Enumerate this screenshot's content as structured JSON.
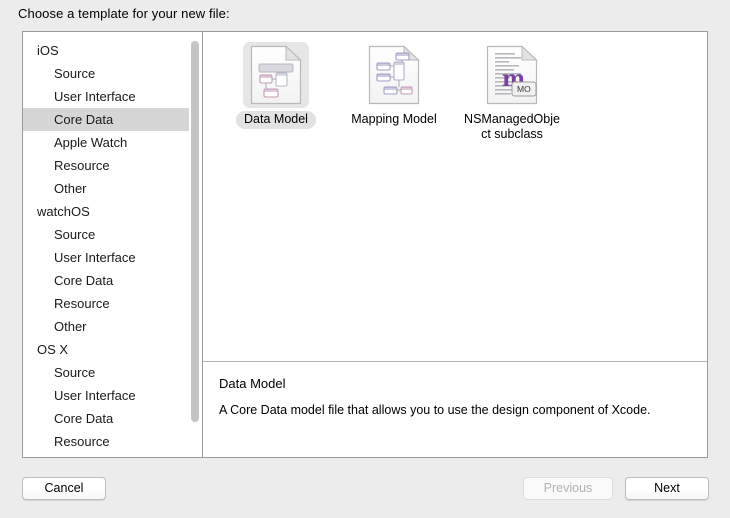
{
  "dialog": {
    "prompt": "Choose a template for your new file:"
  },
  "sidebar": {
    "rows": [
      {
        "label": "iOS",
        "type": "group",
        "selected": false
      },
      {
        "label": "Source",
        "type": "child",
        "selected": false
      },
      {
        "label": "User Interface",
        "type": "child",
        "selected": false
      },
      {
        "label": "Core Data",
        "type": "child",
        "selected": true
      },
      {
        "label": "Apple Watch",
        "type": "child",
        "selected": false
      },
      {
        "label": "Resource",
        "type": "child",
        "selected": false
      },
      {
        "label": "Other",
        "type": "child",
        "selected": false
      },
      {
        "label": "watchOS",
        "type": "group",
        "selected": false
      },
      {
        "label": "Source",
        "type": "child",
        "selected": false
      },
      {
        "label": "User Interface",
        "type": "child",
        "selected": false
      },
      {
        "label": "Core Data",
        "type": "child",
        "selected": false
      },
      {
        "label": "Resource",
        "type": "child",
        "selected": false
      },
      {
        "label": "Other",
        "type": "child",
        "selected": false
      },
      {
        "label": "OS X",
        "type": "group",
        "selected": false
      },
      {
        "label": "Source",
        "type": "child",
        "selected": false
      },
      {
        "label": "User Interface",
        "type": "child",
        "selected": false
      },
      {
        "label": "Core Data",
        "type": "child",
        "selected": false
      },
      {
        "label": "Resource",
        "type": "child",
        "selected": false
      }
    ],
    "scrollbar": {
      "name": "sidebar-scrollbar"
    }
  },
  "templates": [
    {
      "label": "Data Model",
      "icon": "data-model-document-icon",
      "selected": true
    },
    {
      "label": "Mapping Model",
      "icon": "mapping-model-document-icon",
      "selected": false
    },
    {
      "label": "NSManagedObject subclass",
      "icon": "nsmanagedobject-subclass-document-icon",
      "selected": false
    }
  ],
  "description": {
    "title": "Data Model",
    "body": "A Core Data model file that allows you to use the design component of Xcode."
  },
  "footer": {
    "cancel": "Cancel",
    "previous": "Previous",
    "next": "Next"
  },
  "colors": {
    "selection_gray": "#d6d6d6",
    "panel_border": "#9a9a9a",
    "window_background": "#ececec",
    "accent_purple": "#7b3fa0"
  }
}
